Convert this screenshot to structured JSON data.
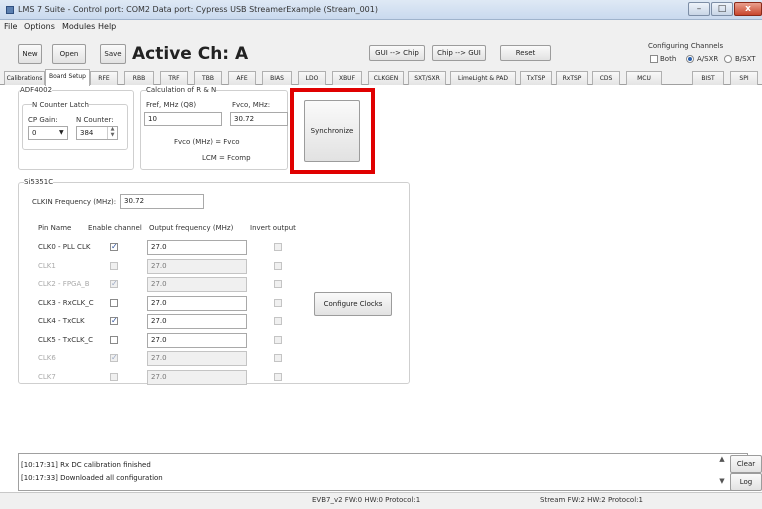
{
  "window": {
    "title": "LMS 7 Suite - Control port: COM2 Data port: Cypress USB StreamerExample (Stream_001)",
    "min_label": "–",
    "max_label": "□",
    "close_label": "x"
  },
  "menu": [
    "File",
    "Options",
    "Modules",
    "Help"
  ],
  "toolbar": {
    "new": "New",
    "open": "Open",
    "save": "Save",
    "active_channel": "Active Ch: A",
    "gui_to_chip": "GUI --> Chip",
    "chip_to_gui": "Chip --> GUI",
    "reset": "Reset",
    "configuring_title": "Configuring Channels",
    "both": "Both",
    "a_sxr": "A/SXR",
    "b_sxt": "B/SXT",
    "both_checked": false,
    "selected_channel": "A/SXR"
  },
  "tabs": [
    "Calibrations",
    "Board Setup",
    "RFE",
    "RBB",
    "TRF",
    "TBB",
    "AFE",
    "BIAS",
    "LDO",
    "XBUF",
    "CLKGEN",
    "SXT/SXR",
    "LimeLight & PAD",
    "TxTSP",
    "RxTSP",
    "CDS",
    "MCU",
    "BIST",
    "SPI"
  ],
  "active_tab": "Board Setup",
  "adf4002": {
    "title": "ADF4002",
    "counter_latch": "N Counter Latch",
    "cp_gain_label": "CP Gain:",
    "cp_gain_value": "0",
    "n_counter_label": "N Counter:",
    "n_counter_value": "384"
  },
  "calc": {
    "title": "Calculation of R & N",
    "fref_label": "Fref, MHz (Q8)",
    "fref_value": "10",
    "fvco_label": "Fvco, MHz:",
    "fvco_value": "30.72",
    "eq1": "Fvco (MHz) = Fvco",
    "eq2": "LCM = Fcomp",
    "sync_button": "Synchronize"
  },
  "si5351": {
    "title": "Si5351C",
    "clkin_label": "CLKIN Frequency (MHz):",
    "clkin_value": "30.72",
    "col_pin": "Pin Name",
    "col_enable": "Enable channel",
    "col_freq": "Output frequency (MHz)",
    "col_invert": "Invert output",
    "configure_button": "Configure Clocks",
    "rows": [
      {
        "name": "CLK0 - PLL CLK",
        "enabled": true,
        "freq": "27.0",
        "invert": false,
        "active": true
      },
      {
        "name": "CLK1",
        "enabled": false,
        "freq": "27.0",
        "invert": false,
        "active": false
      },
      {
        "name": "CLK2 - FPGA_B",
        "enabled": true,
        "freq": "27.0",
        "invert": false,
        "active": false
      },
      {
        "name": "CLK3 - RxCLK_C",
        "enabled": false,
        "freq": "27.0",
        "invert": false,
        "active": true
      },
      {
        "name": "CLK4 - TxCLK",
        "enabled": true,
        "freq": "27.0",
        "invert": false,
        "active": true
      },
      {
        "name": "CLK5 - TxCLK_C",
        "enabled": false,
        "freq": "27.0",
        "invert": false,
        "active": true
      },
      {
        "name": "CLK6",
        "enabled": true,
        "freq": "27.0",
        "invert": false,
        "active": false
      },
      {
        "name": "CLK7",
        "enabled": false,
        "freq": "27.0",
        "invert": false,
        "active": false
      }
    ]
  },
  "log": {
    "lines": [
      "[10:17:31] Rx DC calibration finished",
      "[10:17:33] Downloaded all configuration"
    ],
    "clear": "Clear",
    "log": "Log"
  },
  "statusbar": {
    "left": "EVB7_v2  FW:0 HW:0 Protocol:1",
    "right": "Stream  FW:2 HW:2 Protocol:1"
  },
  "colors": {
    "highlight": "#e00000",
    "checkmark": "#2a4f9a"
  }
}
